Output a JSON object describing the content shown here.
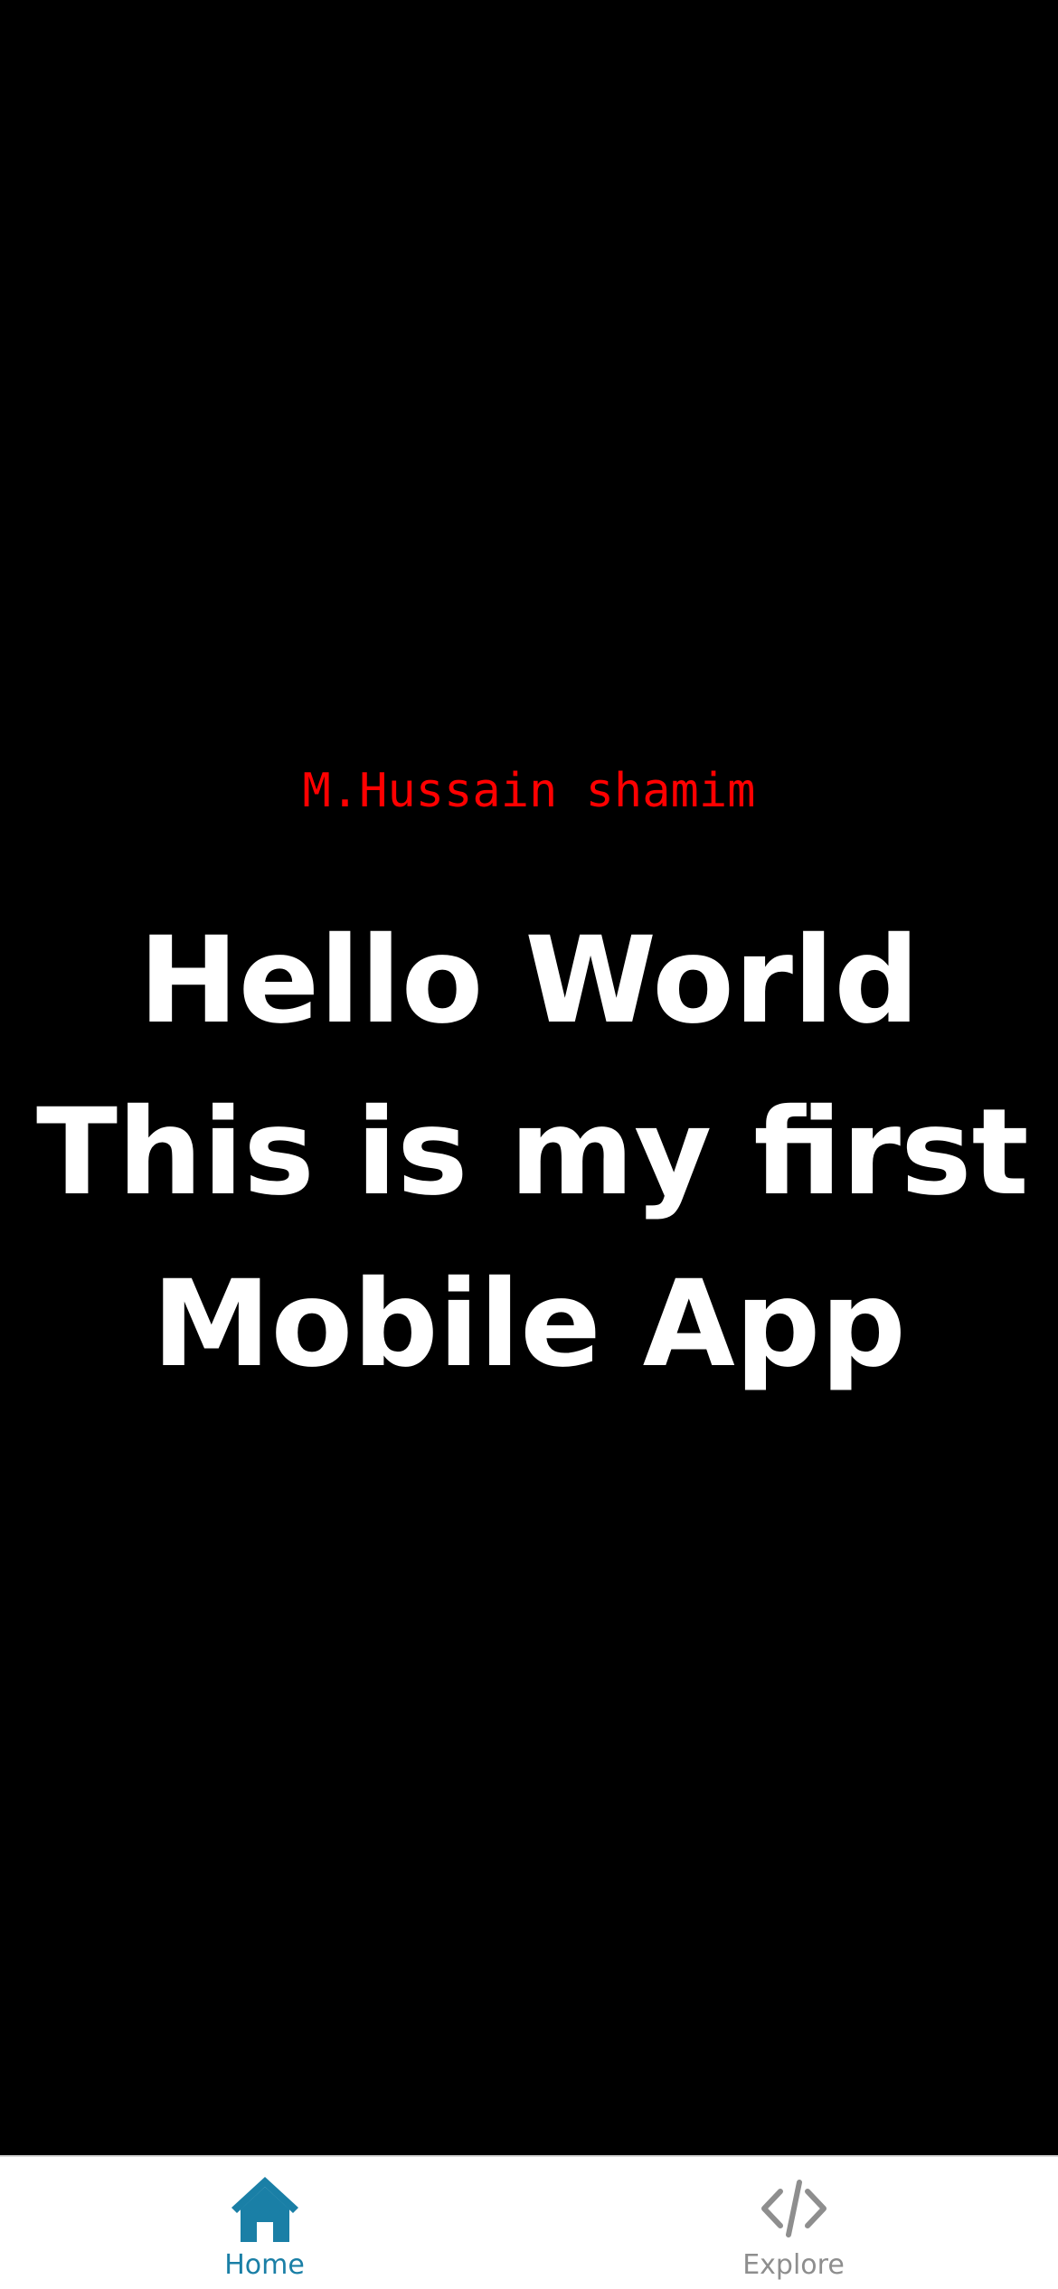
{
  "main": {
    "author": "M.Hussain shamim",
    "greeting_lines": [
      "Hello World",
      "This is my first",
      "Mobile App"
    ]
  },
  "tabbar": {
    "tabs": [
      {
        "label": "Home",
        "icon": "home-icon",
        "active": true
      },
      {
        "label": "Explore",
        "icon": "code-icon",
        "active": false
      }
    ]
  },
  "colors": {
    "background": "#000000",
    "author_text": "#ff0000",
    "greeting_text": "#ffffff",
    "tab_active": "#1a7fa6",
    "tab_inactive": "#8e8e8e",
    "tabbar_background": "#ffffff"
  }
}
